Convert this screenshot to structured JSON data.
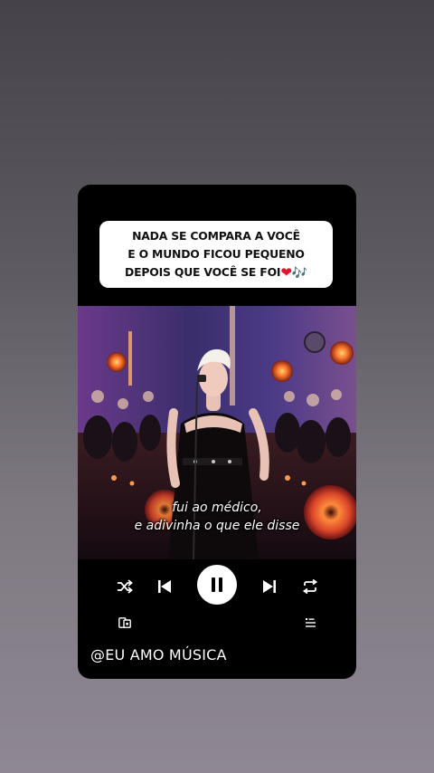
{
  "caption": {
    "line1": "NADA SE COMPARA A VOCÊ",
    "line2": "E O MUNDO FICOU PEQUENO",
    "line3": "DEPOIS QUE VOCÊ SE FOI",
    "heart": "❤",
    "notes": "🎶"
  },
  "video": {
    "subtitle_line1": "fui ao médico,",
    "subtitle_line2": "e adivinha o que ele disse"
  },
  "player": {
    "shuffle_icon": "shuffle-icon",
    "previous_icon": "skip-previous-icon",
    "pause_icon": "pause-icon",
    "next_icon": "skip-next-icon",
    "repeat_icon": "repeat-icon",
    "devices_icon": "connect-devices-icon",
    "queue_icon": "queue-icon"
  },
  "handle": "@EU AMO MÚSICA",
  "colors": {
    "card_background": "#000000",
    "caption_background": "#ffffff",
    "heart": "#e0142b",
    "controls": "#ffffff"
  }
}
